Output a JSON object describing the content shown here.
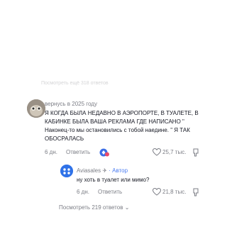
{
  "faded_top_text": "Посмотреть ещё 318 ответов",
  "comment": {
    "username": "вернусь в 2025 году",
    "text_line1": "Я КОГДА БЫЛА НЕДАВНО В АЭРОПОРТЕ, В ТУАЛЕТЕ, В",
    "text_line2": "КАБИНКЕ БЫЛА ВАША РЕКЛАМА ГДЕ НАПИСАНО \"",
    "text_line3": "Наконец-то мы остановились с тобой наедине. \" Я ТАК",
    "text_line4": "ОБОСРАЛАСЬ",
    "time": "6 дн.",
    "reply_label": "Ответить",
    "likes": "25,7 тыс."
  },
  "reply": {
    "username": "Aviasales",
    "author_label": "· Автор",
    "text": "ну хоть в туалет или мимо?",
    "time": "6 дн.",
    "reply_label": "Ответить",
    "likes": "21,8 тыс."
  },
  "view_replies": "Посмотреть 219 ответов",
  "colors": {
    "accent": "#4b7cf1",
    "muted": "#7b7d85",
    "text": "#161823"
  }
}
